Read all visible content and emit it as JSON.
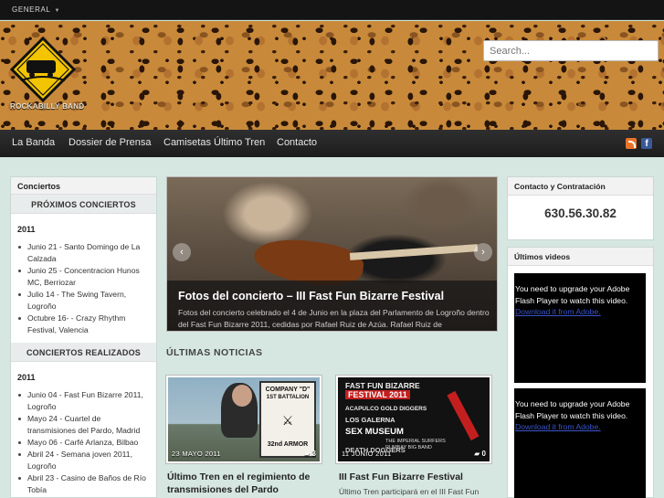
{
  "topbar": {
    "menu_label": "GENERAL"
  },
  "header": {
    "logo_alt": "Último Tren",
    "tagline": "ROCKABILLY BAND",
    "search_placeholder": "Search..."
  },
  "nav": {
    "items": [
      "La Banda",
      "Dossier de Prensa",
      "Camisetas Último Tren",
      "Contacto"
    ]
  },
  "left_sidebar": {
    "title": "Conciertos",
    "upcoming": {
      "heading": "PRÓXIMOS CONCIERTOS",
      "year": "2011",
      "items": [
        "Junio 21 - Santo Domingo de La Calzada",
        "Junio 25 - Concentracion Hunos MC, Berriozar",
        "Julio 14 - The Swing Tavern, Logroño",
        "Octubre 16- - Crazy Rhythm Festival, Valencia"
      ]
    },
    "past": {
      "heading": "CONCIERTOS REALIZADOS",
      "year": "2011",
      "items": [
        "Junio 04 - Fast Fun Bizarre 2011, Logroño",
        "Mayo 24 - Cuartel de transmisiones del Pardo, Madrid",
        "Mayo 06 - Carfé Arlanza, Bilbao",
        "Abril 24 - Semana joven 2011, Logroño",
        "Abril 23 - Casino de Baños de Río Tobía"
      ]
    }
  },
  "slider": {
    "title": "Fotos del concierto – III Fast Fun Bizarre Festival",
    "text": "Fotos del concierto celebrado el 4 de Junio en la plaza del Parlamento de Logroño dentro del Fast Fun Bizarre 2011, cedidas por Rafael Ruiz de Azúa. Rafael Ruiz de",
    "prev": "‹",
    "next": "›"
  },
  "news": {
    "heading": "ÚLTIMAS NOTICIAS",
    "cards": [
      {
        "date": "23 MAYO 2011",
        "comments": "3",
        "title": "Último Tren en el regimiento de transmisiones del Pardo",
        "excerpt": "",
        "sign_lines": [
          "COMPANY \"D\"",
          "1ST BATTALION",
          "32nd ARMOR"
        ]
      },
      {
        "date": "11 JUNIO 2011",
        "comments": "0",
        "title": "III Fast Fun Bizarre Festival",
        "excerpt": "Último Tren participará en el III Fast Fun",
        "poster_lines": [
          "FAST FUN BIZARRE",
          "FESTIVAL 2011",
          "ACAPULCO GOLD DIGGERS",
          "LOS GALERNA",
          "SEX MUSEUM",
          "THE IMPERIAL SURFERS",
          "RUMBAY BIG BAND",
          "DEATH DOGGERS"
        ]
      }
    ]
  },
  "right_sidebar": {
    "contact_title": "Contacto y Contratación",
    "phone": "630.56.30.82",
    "videos_title": "Últimos videos",
    "flash_message": "You need to upgrade your Adobe Flash Player to watch this video.",
    "flash_link": "Download it from Adobe."
  },
  "colors": {
    "accent_nav": "#1c1c1c",
    "page_bg": "#d6e7e1",
    "logo_yellow": "#f3c400"
  }
}
